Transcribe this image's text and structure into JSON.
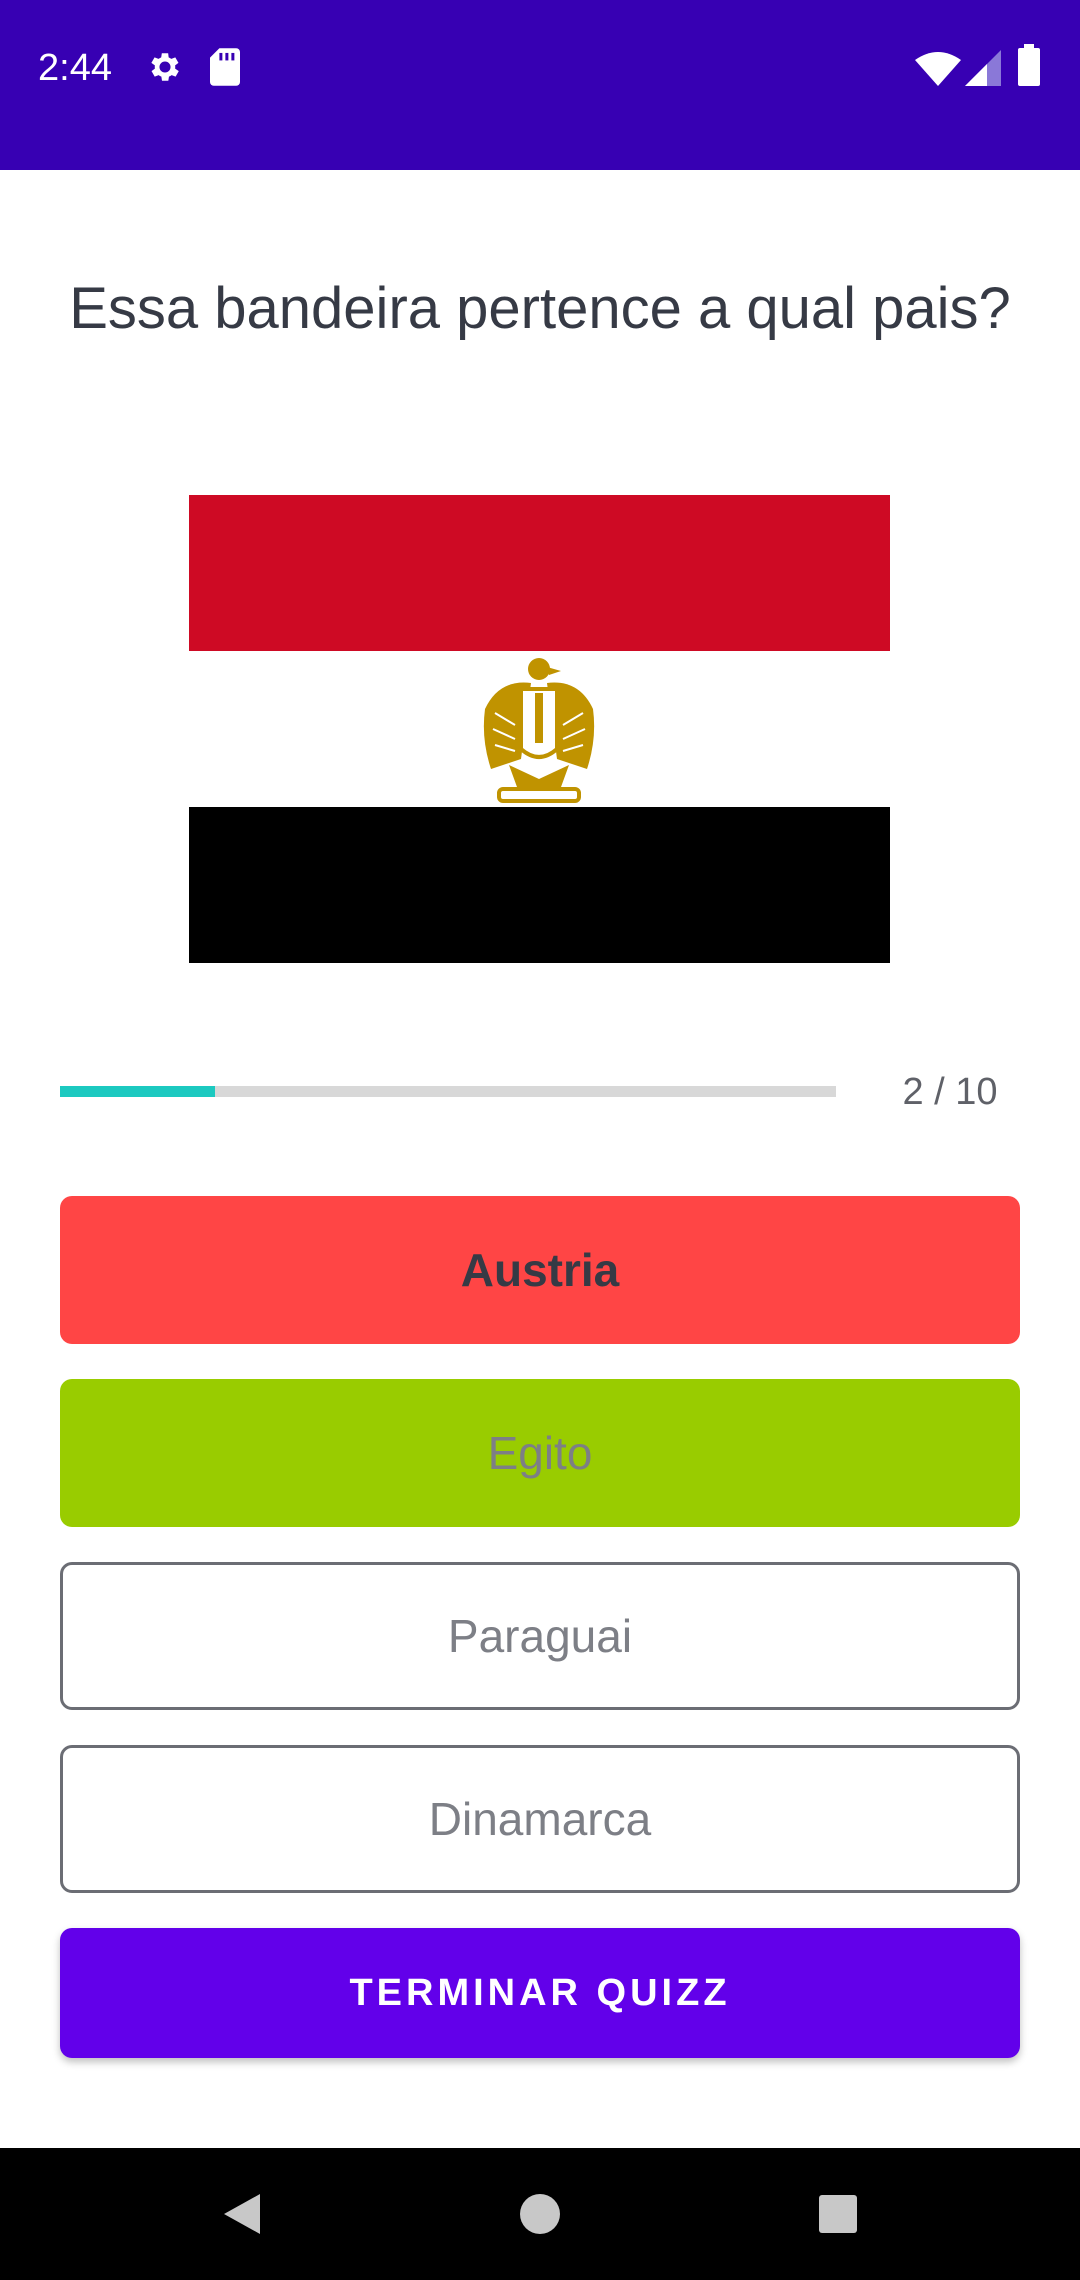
{
  "status_bar": {
    "time": "2:44",
    "icons": [
      "gear-icon",
      "sd-card-icon",
      "wifi-icon",
      "signal-icon",
      "battery-icon"
    ],
    "background": "#3700b3"
  },
  "quiz": {
    "question": "Essa bandeira pertence a qual pais?",
    "flag": {
      "country_icon": "egypt-flag",
      "colors": [
        "#ce0a24",
        "#ffffff",
        "#000000"
      ],
      "emblem_color": "#c09300"
    },
    "progress": {
      "text": "2 / 10",
      "fraction": 0.2,
      "fill_color": "#1cc9c0"
    },
    "answers": [
      {
        "label": "Austria",
        "state": "wrong",
        "color": "#ff4545"
      },
      {
        "label": "Egito",
        "state": "correct",
        "color": "#99cc00"
      },
      {
        "label": "Paraguai",
        "state": "neutral"
      },
      {
        "label": "Dinamarca",
        "state": "neutral"
      }
    ],
    "finish_label": "TERMINAR QUIZZ",
    "finish_color": "#6200ea"
  },
  "nav_bar": {
    "icons": [
      "back-icon",
      "home-icon",
      "recents-icon"
    ]
  }
}
